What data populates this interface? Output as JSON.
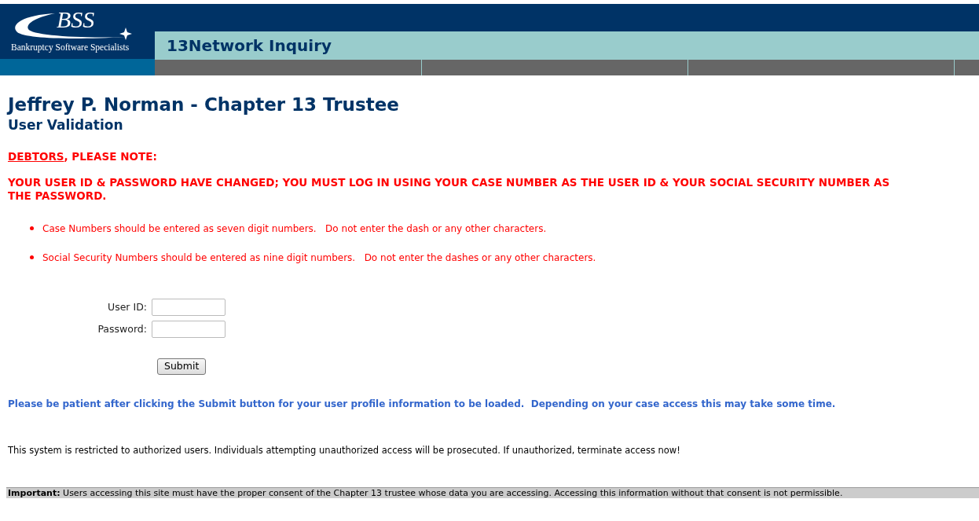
{
  "header": {
    "logo_text": "BSS",
    "logo_tagline": "Bankruptcy Software Specialists",
    "app_title": "13Network Inquiry"
  },
  "page": {
    "title": "Jeffrey P. Norman - Chapter 13 Trustee",
    "subtitle": "User Validation"
  },
  "notice": {
    "link": "DEBTORS",
    "lead": ", PLEASE NOTE:",
    "message": "YOUR USER ID & PASSWORD HAVE CHANGED; YOU MUST LOG IN USING YOUR CASE NUMBER AS THE USER ID & YOUR SOCIAL SECURITY NUMBER AS THE PASSWORD.",
    "bullets": [
      "Case Numbers should be entered as seven digit numbers.   Do not enter the dash or any other characters.",
      "Social Security Numbers should be entered as nine digit numbers.   Do not enter the dashes or any other characters."
    ]
  },
  "form": {
    "fields": [
      {
        "label": "User ID:"
      },
      {
        "label": "Password:"
      }
    ],
    "submit": "Submit"
  },
  "patience_note": "Please be patient after clicking the Submit button for your user profile information to be loaded.  Depending on your case access this may take some time.",
  "restriction": "This system is restricted to authorized users. Individuals attempting unauthorized access will be prosecuted. If unauthorized, terminate access now!",
  "important": "**Important:** Users accessing this site must have the proper consent of the Chapter 13 trustee whose data you are accessing. Accessing this information without that consent is not permissible."
}
